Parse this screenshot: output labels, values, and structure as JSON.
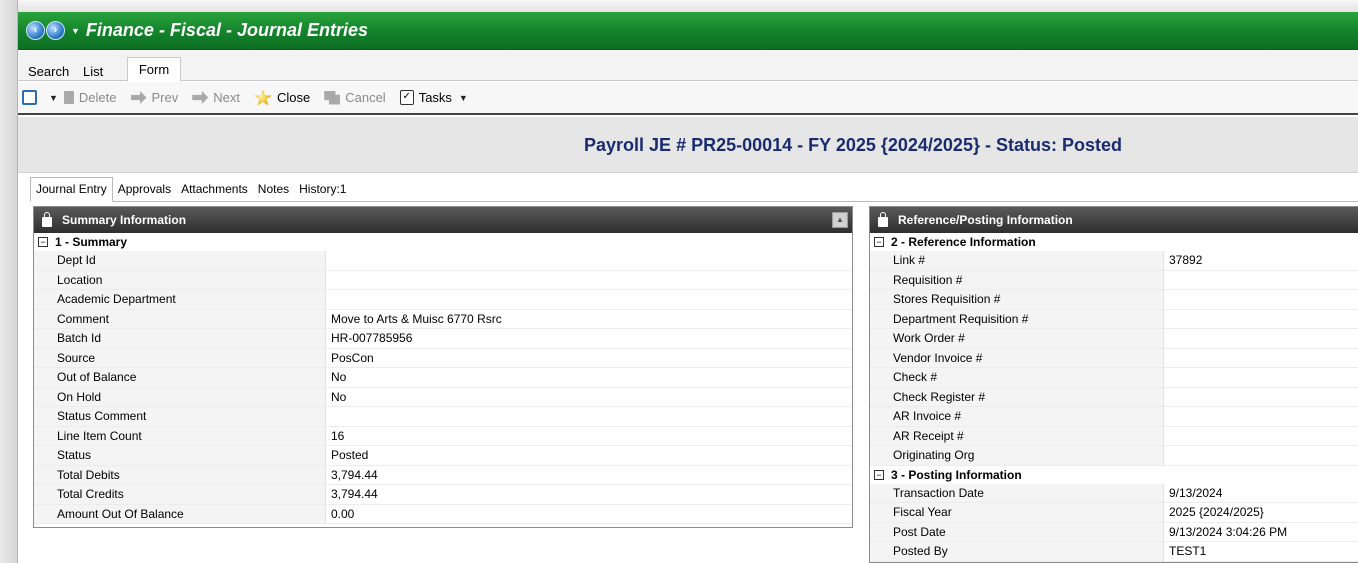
{
  "app": {
    "title": "Finance - Fiscal - Journal Entries"
  },
  "top_tabs": [
    "Search",
    "List",
    "Form"
  ],
  "toolbar": {
    "delete": "Delete",
    "prev": "Prev",
    "next": "Next",
    "close": "Close",
    "cancel": "Cancel",
    "tasks": "Tasks"
  },
  "record": {
    "title": "Payroll JE # PR25-00014 - FY 2025 {2024/2025} - Status: Posted"
  },
  "sub_tabs": [
    "Journal Entry",
    "Approvals",
    "Attachments",
    "Notes",
    "History:1"
  ],
  "summary_panel": {
    "title": "Summary Information",
    "section": "1 - Summary",
    "rows": [
      {
        "label": "Dept Id",
        "value": ""
      },
      {
        "label": "Location",
        "value": ""
      },
      {
        "label": "Academic Department",
        "value": ""
      },
      {
        "label": "Comment",
        "value": "Move to Arts & Muisc 6770 Rsrc"
      },
      {
        "label": "Batch Id",
        "value": "HR-007785956"
      },
      {
        "label": "Source",
        "value": "PosCon"
      },
      {
        "label": "Out of Balance",
        "value": "No"
      },
      {
        "label": "On Hold",
        "value": "No"
      },
      {
        "label": "Status Comment",
        "value": ""
      },
      {
        "label": "Line Item Count",
        "value": "16"
      },
      {
        "label": "Status",
        "value": "Posted"
      },
      {
        "label": "Total Debits",
        "value": "3,794.44"
      },
      {
        "label": "Total Credits",
        "value": "3,794.44"
      },
      {
        "label": "Amount Out Of Balance",
        "value": "0.00"
      }
    ]
  },
  "ref_panel": {
    "title": "Reference/Posting Information",
    "section_ref": "2 - Reference Information",
    "ref_rows": [
      {
        "label": "Link #",
        "value": "37892"
      },
      {
        "label": "Requisition #",
        "value": ""
      },
      {
        "label": "Stores Requisition #",
        "value": ""
      },
      {
        "label": "Department Requisition #",
        "value": ""
      },
      {
        "label": "Work Order #",
        "value": ""
      },
      {
        "label": "Vendor Invoice #",
        "value": ""
      },
      {
        "label": "Check #",
        "value": ""
      },
      {
        "label": "Check Register #",
        "value": ""
      },
      {
        "label": "AR Invoice #",
        "value": ""
      },
      {
        "label": "AR Receipt #",
        "value": ""
      },
      {
        "label": "Originating Org",
        "value": ""
      }
    ],
    "section_post": "3 - Posting Information",
    "post_rows": [
      {
        "label": "Transaction Date",
        "value": "9/13/2024"
      },
      {
        "label": "Fiscal Year",
        "value": "2025 {2024/2025}"
      },
      {
        "label": "Post Date",
        "value": "9/13/2024 3:04:26 PM"
      },
      {
        "label": "Posted By",
        "value": "TEST1"
      }
    ]
  }
}
